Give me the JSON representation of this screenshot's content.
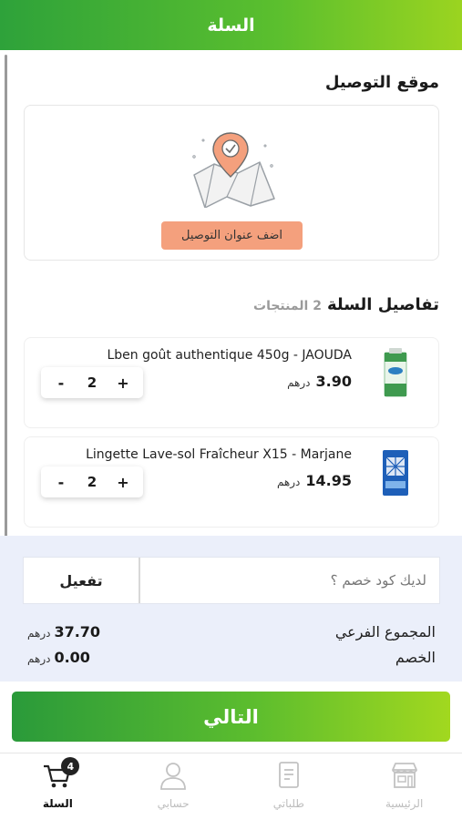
{
  "header": {
    "title": "السلة"
  },
  "delivery": {
    "section_title": "موقع التوصيل",
    "add_address_label": "اضف عنوان التوصيل"
  },
  "cart": {
    "section_title": "تفاصيل السلة",
    "products_count": "2 المنتجات",
    "items": [
      {
        "name": "Lben goût authentique 450g - JAOUDA",
        "price": "3.90",
        "currency": "درهم",
        "quantity": "2",
        "minus": "-",
        "plus": "+"
      },
      {
        "name": "Lingette Lave-sol Fraîcheur X15 - Marjane",
        "price": "14.95",
        "currency": "درهم",
        "quantity": "2",
        "minus": "-",
        "plus": "+"
      }
    ]
  },
  "promo": {
    "placeholder": "لديك كود خصم ؟",
    "activate_label": "تفعيل"
  },
  "totals": {
    "subtotal_label": "المجموع الفرعي",
    "subtotal_value": "37.70",
    "discount_label": "الخصم",
    "discount_value": "0.00",
    "currency": "درهم"
  },
  "next_button": {
    "label": "التالي"
  },
  "tabbar": {
    "tabs": [
      {
        "label": "الرئيسية",
        "icon": "store-icon"
      },
      {
        "label": "طلباتي",
        "icon": "orders-icon"
      },
      {
        "label": "حسابي",
        "icon": "user-icon"
      },
      {
        "label": "السلة",
        "icon": "cart-icon",
        "badge": "4",
        "active": true
      }
    ]
  },
  "colors": {
    "brand_green": "#5bbf2e",
    "accent_orange": "#f4a07d",
    "panel_bg": "#ebeffa"
  }
}
